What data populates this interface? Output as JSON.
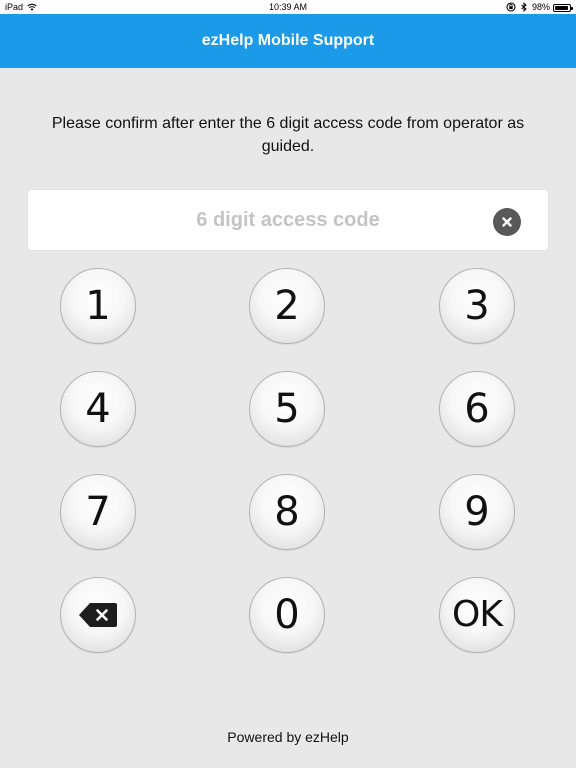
{
  "status_bar": {
    "device": "iPad",
    "time": "10:39 AM",
    "battery": "98%",
    "icons": [
      "wifi-icon",
      "rotation-lock-icon",
      "bluetooth-icon",
      "battery-icon"
    ]
  },
  "header": {
    "title": "ezHelp Mobile Support",
    "background_color": "#1a9ae8"
  },
  "instruction": "Please confirm after enter the 6 digit access code from operator as guided.",
  "code_input": {
    "value": "",
    "placeholder": "6 digit access code",
    "clear_icon": "clear-icon"
  },
  "keypad": {
    "keys": {
      "k1": "1",
      "k2": "2",
      "k3": "3",
      "k4": "4",
      "k5": "5",
      "k6": "6",
      "k7": "7",
      "k8": "8",
      "k9": "9",
      "k0": "0",
      "ok": "OK"
    },
    "backspace_icon": "backspace-icon"
  },
  "footer": "Powered by ezHelp"
}
